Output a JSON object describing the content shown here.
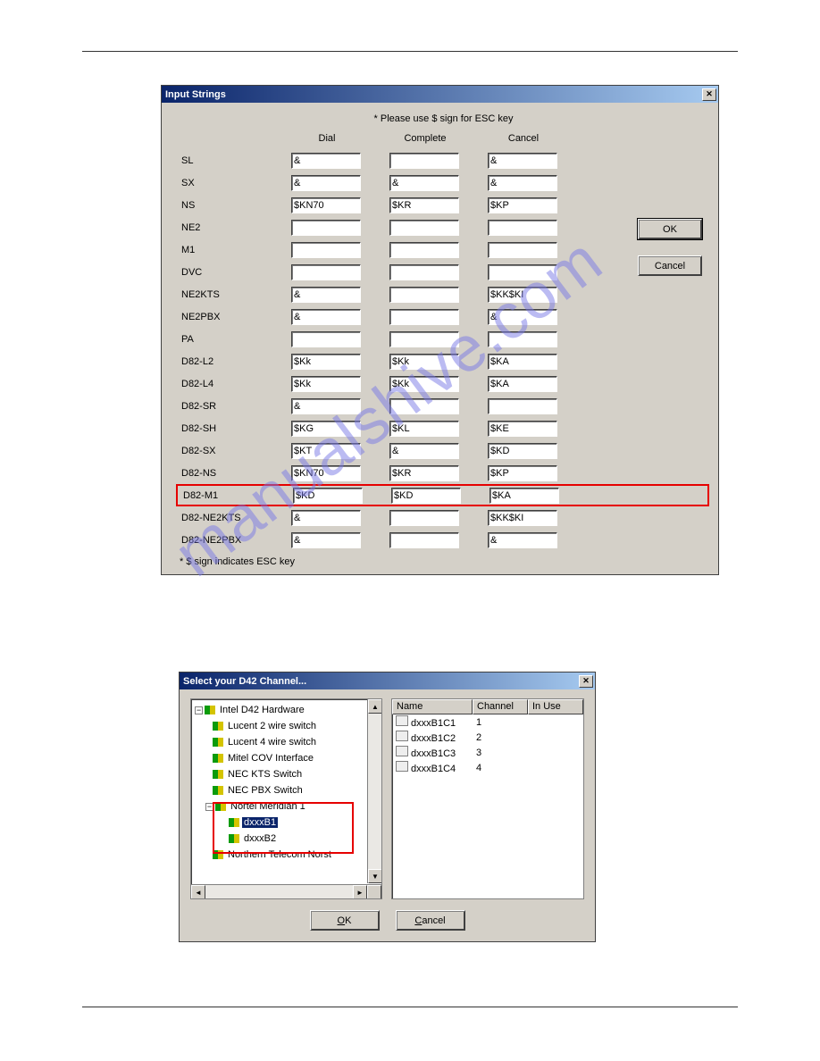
{
  "watermark": "manualshive.com",
  "dlg1": {
    "title": "Input Strings",
    "hint": "* Please use $ sign for ESC key",
    "columns": {
      "dial": "Dial",
      "complete": "Complete",
      "cancel": "Cancel"
    },
    "rows": [
      {
        "label": "SL",
        "dial": "&",
        "complete": "",
        "cancel": "&",
        "hl": false
      },
      {
        "label": "SX",
        "dial": "&",
        "complete": "&",
        "cancel": "&",
        "hl": false
      },
      {
        "label": "NS",
        "dial": "$KN70",
        "complete": "$KR",
        "cancel": "$KP",
        "hl": false
      },
      {
        "label": "NE2",
        "dial": "",
        "complete": "",
        "cancel": "",
        "hl": false
      },
      {
        "label": "M1",
        "dial": "",
        "complete": "",
        "cancel": "",
        "hl": false
      },
      {
        "label": "DVC",
        "dial": "",
        "complete": "",
        "cancel": "",
        "hl": false
      },
      {
        "label": "NE2KTS",
        "dial": "&",
        "complete": "",
        "cancel": "$KK$KI",
        "hl": false
      },
      {
        "label": "NE2PBX",
        "dial": "&",
        "complete": "",
        "cancel": "&",
        "hl": false
      },
      {
        "label": "PA",
        "dial": "",
        "complete": "",
        "cancel": "",
        "hl": false
      },
      {
        "label": "D82-L2",
        "dial": "$Kk",
        "complete": "$Kk",
        "cancel": "$KA",
        "hl": false
      },
      {
        "label": "D82-L4",
        "dial": "$Kk",
        "complete": "$Kk",
        "cancel": "$KA",
        "hl": false
      },
      {
        "label": "D82-SR",
        "dial": "&",
        "complete": "",
        "cancel": "",
        "hl": false
      },
      {
        "label": "D82-SH",
        "dial": "$KG",
        "complete": "$KL",
        "cancel": "$KE",
        "hl": false
      },
      {
        "label": "D82-SX",
        "dial": "$KT",
        "complete": "&",
        "cancel": "$KD",
        "hl": false
      },
      {
        "label": "D82-NS",
        "dial": "$KN70",
        "complete": "$KR",
        "cancel": "$KP",
        "hl": false
      },
      {
        "label": "D82-M1",
        "dial": "$KD",
        "complete": "$KD",
        "cancel": "$KA",
        "hl": true
      },
      {
        "label": "D82-NE2KTS",
        "dial": "&",
        "complete": "",
        "cancel": "$KK$KI",
        "hl": false
      },
      {
        "label": "D82-NE2PBX",
        "dial": "&",
        "complete": "",
        "cancel": "&",
        "hl": false
      }
    ],
    "foot": "* $ sign indicates ESC key",
    "ok": "OK",
    "cancel": "Cancel"
  },
  "dlg2": {
    "title": "Select your D42 Channel...",
    "tree": {
      "root": "Intel D42 Hardware",
      "items": [
        "Lucent 2 wire switch",
        "Lucent 4 wire switch",
        "Mitel COV Interface",
        "NEC KTS Switch",
        "NEC PBX Switch"
      ],
      "expanded": {
        "label": "Nortel Meridian 1",
        "children": [
          "dxxxB1",
          "dxxxB2"
        ],
        "selected": "dxxxB1"
      },
      "last": "Northern Telecom Norst"
    },
    "list": {
      "columns": {
        "name": "Name",
        "channel": "Channel",
        "inuse": "In Use"
      },
      "rows": [
        {
          "name": "dxxxB1C1",
          "channel": "1",
          "inuse": ""
        },
        {
          "name": "dxxxB1C2",
          "channel": "2",
          "inuse": ""
        },
        {
          "name": "dxxxB1C3",
          "channel": "3",
          "inuse": ""
        },
        {
          "name": "dxxxB1C4",
          "channel": "4",
          "inuse": ""
        }
      ]
    },
    "ok": "OK",
    "cancel": "Cancel"
  }
}
